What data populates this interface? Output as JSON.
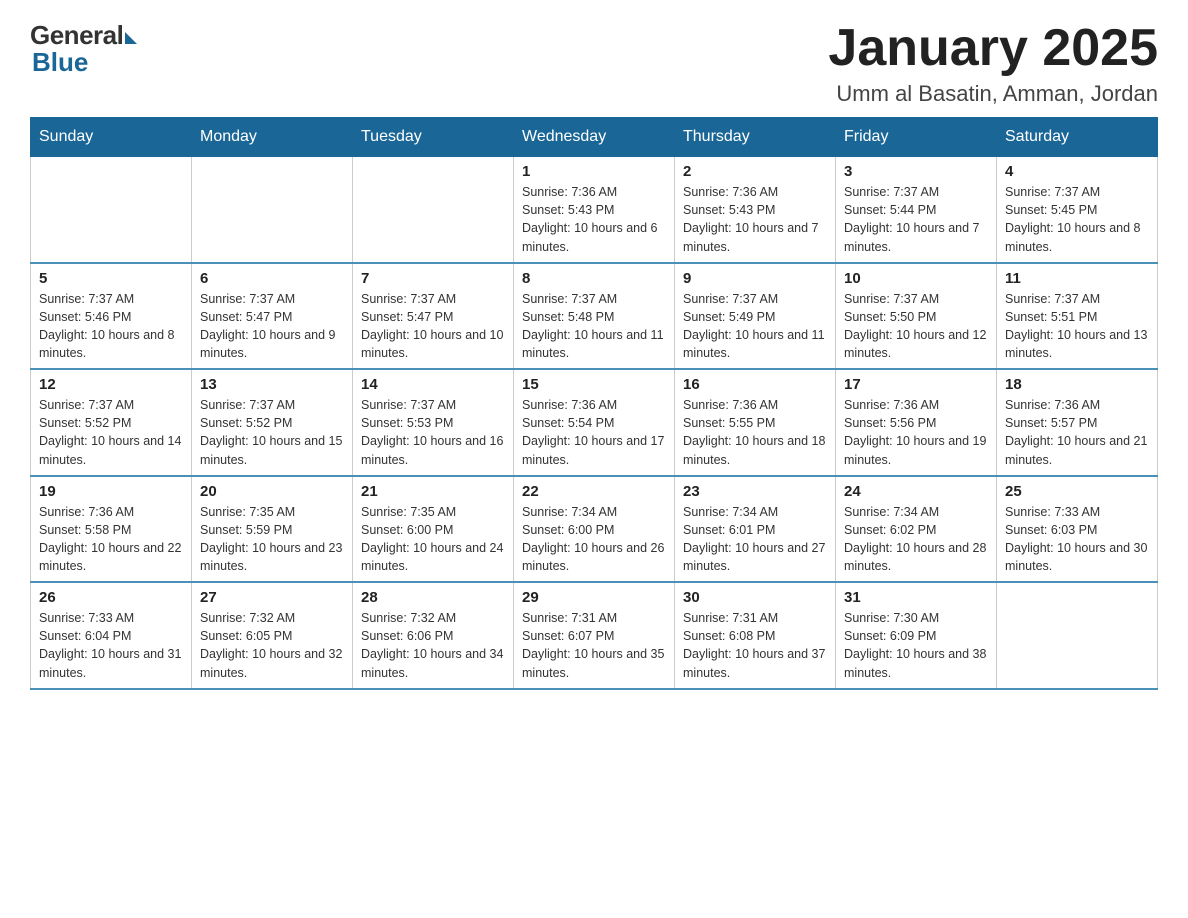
{
  "logo": {
    "general": "General",
    "blue": "Blue"
  },
  "title": "January 2025",
  "subtitle": "Umm al Basatin, Amman, Jordan",
  "days_of_week": [
    "Sunday",
    "Monday",
    "Tuesday",
    "Wednesday",
    "Thursday",
    "Friday",
    "Saturday"
  ],
  "weeks": [
    [
      {
        "day": "",
        "info": ""
      },
      {
        "day": "",
        "info": ""
      },
      {
        "day": "",
        "info": ""
      },
      {
        "day": "1",
        "info": "Sunrise: 7:36 AM\nSunset: 5:43 PM\nDaylight: 10 hours and 6 minutes."
      },
      {
        "day": "2",
        "info": "Sunrise: 7:36 AM\nSunset: 5:43 PM\nDaylight: 10 hours and 7 minutes."
      },
      {
        "day": "3",
        "info": "Sunrise: 7:37 AM\nSunset: 5:44 PM\nDaylight: 10 hours and 7 minutes."
      },
      {
        "day": "4",
        "info": "Sunrise: 7:37 AM\nSunset: 5:45 PM\nDaylight: 10 hours and 8 minutes."
      }
    ],
    [
      {
        "day": "5",
        "info": "Sunrise: 7:37 AM\nSunset: 5:46 PM\nDaylight: 10 hours and 8 minutes."
      },
      {
        "day": "6",
        "info": "Sunrise: 7:37 AM\nSunset: 5:47 PM\nDaylight: 10 hours and 9 minutes."
      },
      {
        "day": "7",
        "info": "Sunrise: 7:37 AM\nSunset: 5:47 PM\nDaylight: 10 hours and 10 minutes."
      },
      {
        "day": "8",
        "info": "Sunrise: 7:37 AM\nSunset: 5:48 PM\nDaylight: 10 hours and 11 minutes."
      },
      {
        "day": "9",
        "info": "Sunrise: 7:37 AM\nSunset: 5:49 PM\nDaylight: 10 hours and 11 minutes."
      },
      {
        "day": "10",
        "info": "Sunrise: 7:37 AM\nSunset: 5:50 PM\nDaylight: 10 hours and 12 minutes."
      },
      {
        "day": "11",
        "info": "Sunrise: 7:37 AM\nSunset: 5:51 PM\nDaylight: 10 hours and 13 minutes."
      }
    ],
    [
      {
        "day": "12",
        "info": "Sunrise: 7:37 AM\nSunset: 5:52 PM\nDaylight: 10 hours and 14 minutes."
      },
      {
        "day": "13",
        "info": "Sunrise: 7:37 AM\nSunset: 5:52 PM\nDaylight: 10 hours and 15 minutes."
      },
      {
        "day": "14",
        "info": "Sunrise: 7:37 AM\nSunset: 5:53 PM\nDaylight: 10 hours and 16 minutes."
      },
      {
        "day": "15",
        "info": "Sunrise: 7:36 AM\nSunset: 5:54 PM\nDaylight: 10 hours and 17 minutes."
      },
      {
        "day": "16",
        "info": "Sunrise: 7:36 AM\nSunset: 5:55 PM\nDaylight: 10 hours and 18 minutes."
      },
      {
        "day": "17",
        "info": "Sunrise: 7:36 AM\nSunset: 5:56 PM\nDaylight: 10 hours and 19 minutes."
      },
      {
        "day": "18",
        "info": "Sunrise: 7:36 AM\nSunset: 5:57 PM\nDaylight: 10 hours and 21 minutes."
      }
    ],
    [
      {
        "day": "19",
        "info": "Sunrise: 7:36 AM\nSunset: 5:58 PM\nDaylight: 10 hours and 22 minutes."
      },
      {
        "day": "20",
        "info": "Sunrise: 7:35 AM\nSunset: 5:59 PM\nDaylight: 10 hours and 23 minutes."
      },
      {
        "day": "21",
        "info": "Sunrise: 7:35 AM\nSunset: 6:00 PM\nDaylight: 10 hours and 24 minutes."
      },
      {
        "day": "22",
        "info": "Sunrise: 7:34 AM\nSunset: 6:00 PM\nDaylight: 10 hours and 26 minutes."
      },
      {
        "day": "23",
        "info": "Sunrise: 7:34 AM\nSunset: 6:01 PM\nDaylight: 10 hours and 27 minutes."
      },
      {
        "day": "24",
        "info": "Sunrise: 7:34 AM\nSunset: 6:02 PM\nDaylight: 10 hours and 28 minutes."
      },
      {
        "day": "25",
        "info": "Sunrise: 7:33 AM\nSunset: 6:03 PM\nDaylight: 10 hours and 30 minutes."
      }
    ],
    [
      {
        "day": "26",
        "info": "Sunrise: 7:33 AM\nSunset: 6:04 PM\nDaylight: 10 hours and 31 minutes."
      },
      {
        "day": "27",
        "info": "Sunrise: 7:32 AM\nSunset: 6:05 PM\nDaylight: 10 hours and 32 minutes."
      },
      {
        "day": "28",
        "info": "Sunrise: 7:32 AM\nSunset: 6:06 PM\nDaylight: 10 hours and 34 minutes."
      },
      {
        "day": "29",
        "info": "Sunrise: 7:31 AM\nSunset: 6:07 PM\nDaylight: 10 hours and 35 minutes."
      },
      {
        "day": "30",
        "info": "Sunrise: 7:31 AM\nSunset: 6:08 PM\nDaylight: 10 hours and 37 minutes."
      },
      {
        "day": "31",
        "info": "Sunrise: 7:30 AM\nSunset: 6:09 PM\nDaylight: 10 hours and 38 minutes."
      },
      {
        "day": "",
        "info": ""
      }
    ]
  ]
}
